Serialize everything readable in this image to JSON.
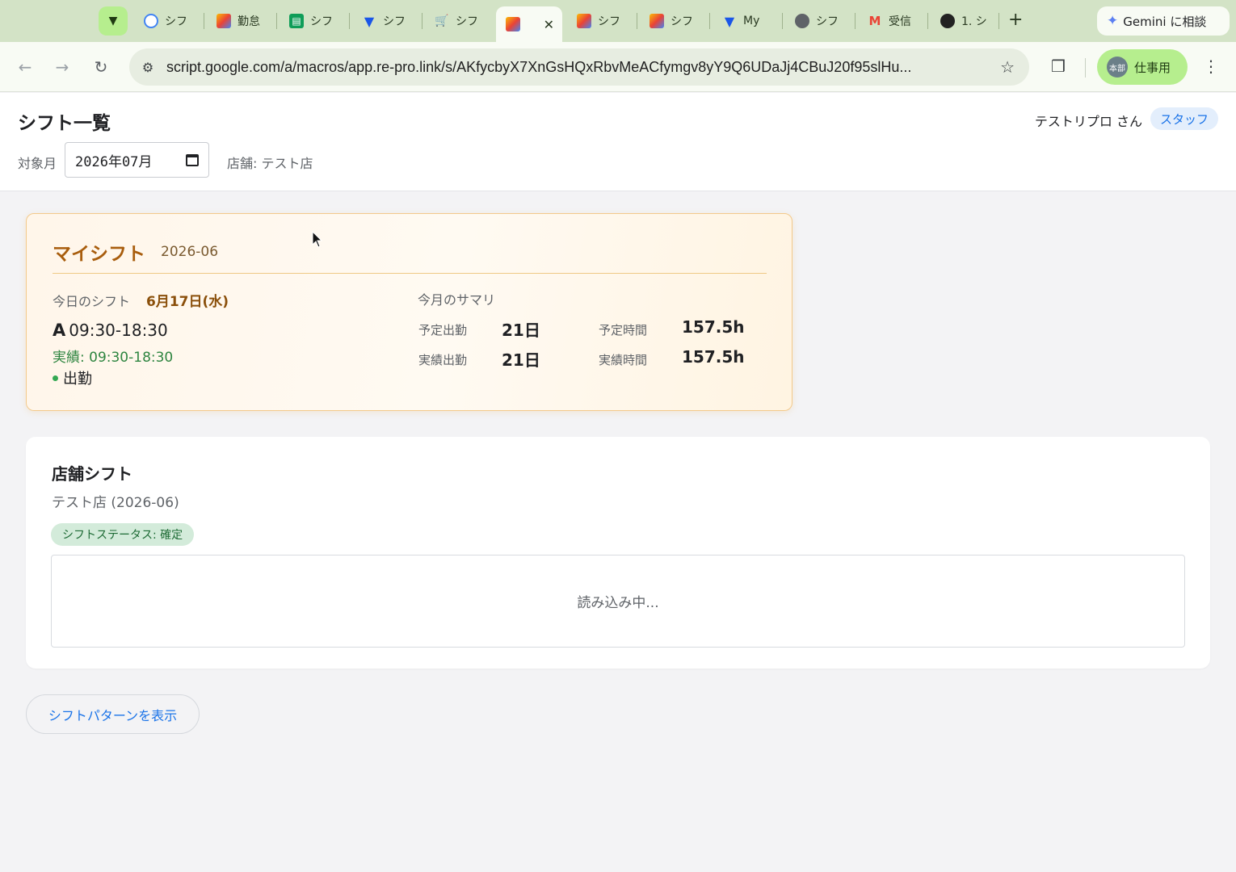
{
  "browser": {
    "tabs": [
      {
        "label": "シフ",
        "icon": "chrome-icon",
        "color": "#4285f4"
      },
      {
        "label": "勤怠",
        "icon": "apps-script-icon",
        "color": "#ea4335"
      },
      {
        "label": "シフ",
        "icon": "sheets-icon",
        "color": "#0f9d58"
      },
      {
        "label": "シフ",
        "icon": "v-icon",
        "color": "#1a56e8"
      },
      {
        "label": "シフ",
        "icon": "cart-icon",
        "color": "#4aa0d8"
      },
      {
        "label": "",
        "icon": "apps-script-icon",
        "color": "#ea4335",
        "active": true
      },
      {
        "label": "シフ",
        "icon": "apps-script-icon",
        "color": "#ea4335"
      },
      {
        "label": "シフ",
        "icon": "apps-script-icon",
        "color": "#ea4335"
      },
      {
        "label": "My",
        "icon": "v-icon",
        "color": "#1a56e8"
      },
      {
        "label": "シフ",
        "icon": "globe-icon",
        "color": "#5f6368"
      },
      {
        "label": "受信",
        "icon": "gmail-icon",
        "color": "#ea4335"
      },
      {
        "label": "1. シ",
        "icon": "notion-icon",
        "color": "#222222"
      }
    ],
    "gemini_label": "Gemini に相談",
    "url": "script.google.com/a/macros/app.re-pro.link/s/AKfycbyX7XnGsHQxRbvMeACfymgv8yY9Q6UDaJj4CBuJ20f95slHu...",
    "profile_avatar": "本部",
    "profile_label": "仕事用"
  },
  "header": {
    "title": "シフト一覧",
    "user_name": "テストリプロ さん",
    "role": "スタッフ",
    "month_label": "対象月",
    "month_value": "2026年07月",
    "store_label": "店舗: テスト店"
  },
  "my_shift": {
    "title": "マイシフト",
    "month": "2026-06",
    "today_label": "今日のシフト",
    "today_date": "6月17日(水)",
    "shift_code": "A",
    "shift_time": "09:30-18:30",
    "actual": "実績: 09:30-18:30",
    "attendance": "出勤",
    "summary_label": "今月のサマリ",
    "summary": {
      "planned_days_label": "予定出勤",
      "planned_days": "21日",
      "planned_hours_label": "予定時間",
      "planned_hours": "157.5h",
      "actual_days_label": "実績出勤",
      "actual_days": "21日",
      "actual_hours_label": "実績時間",
      "actual_hours": "157.5h"
    }
  },
  "store_shift": {
    "title": "店舗シフト",
    "subtitle": "テスト店 (2026-06)",
    "status": "シフトステータス: 確定",
    "loading": "読み込み中..."
  },
  "pattern_button": "シフトパターンを表示"
}
